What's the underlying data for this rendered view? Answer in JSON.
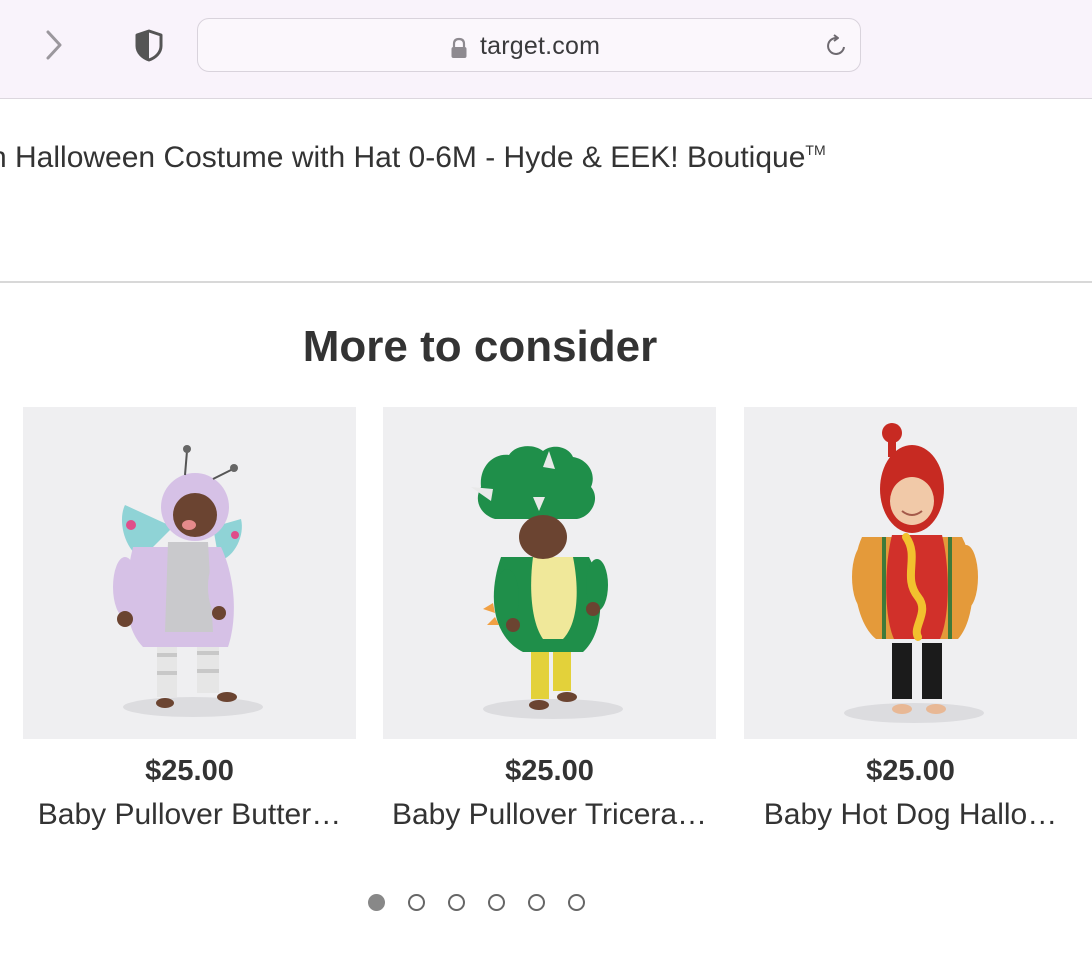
{
  "browser": {
    "url": "target.com",
    "forward_icon": "chevron-right-icon",
    "privacy_icon": "shield-icon",
    "lock_icon": "lock-icon",
    "reload_icon": "reload-icon"
  },
  "product": {
    "title_partial": "n Halloween Costume with Hat 0-6M - Hyde & EEK! Boutique",
    "trademark": "TM"
  },
  "more_to_consider": {
    "heading": "More to consider",
    "items": [
      {
        "price": "$25.00",
        "name": "Baby Pullover Butter…"
      },
      {
        "price": "$25.00",
        "name": "Baby Pullover Tricera…"
      },
      {
        "price": "$25.00",
        "name": "Baby Hot Dog Hallo…"
      }
    ],
    "carousel": {
      "pages": 6,
      "current": 1
    }
  },
  "colors": {
    "toolbar_bg": "#f9f3fb",
    "image_bg": "#efeff1",
    "text": "#333333"
  }
}
